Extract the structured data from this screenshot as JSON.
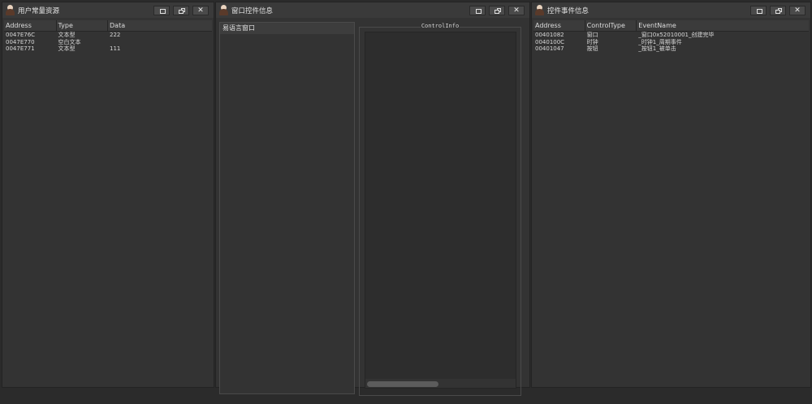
{
  "window_buttons": {
    "maximize": "maximize-icon",
    "restore": "restore-icon",
    "close": "✕"
  },
  "left_panel": {
    "title": "用户常量资源",
    "columns": [
      "Address",
      "Type",
      "Data"
    ],
    "rows": [
      {
        "address": "0047E76C",
        "type": "文本型",
        "data": "222"
      },
      {
        "address": "0047E770",
        "type": "空白文本",
        "data": ""
      },
      {
        "address": "0047E771",
        "type": "文本型",
        "data": "111"
      }
    ]
  },
  "middle_panel": {
    "title": "窗口控件信息",
    "tree_items": [
      "易语言窗口"
    ],
    "group_title": "ControlInfo"
  },
  "right_panel": {
    "title": "控件事件信息",
    "columns": [
      "Address",
      "ControlType",
      "EventName"
    ],
    "rows": [
      {
        "address": "00401082",
        "control_type": "窗口",
        "event_name": "_窗口0x52010001_创建完毕"
      },
      {
        "address": "0040100C",
        "control_type": "时钟",
        "event_name": "_时钟1_周期事件"
      },
      {
        "address": "00401047",
        "control_type": "按钮",
        "event_name": "_按钮1_被单击"
      }
    ]
  },
  "colors": {
    "background": "#2b2b2b",
    "panel": "#333333",
    "titlebar": "#3a3a3a",
    "text": "#d6d6d6"
  }
}
